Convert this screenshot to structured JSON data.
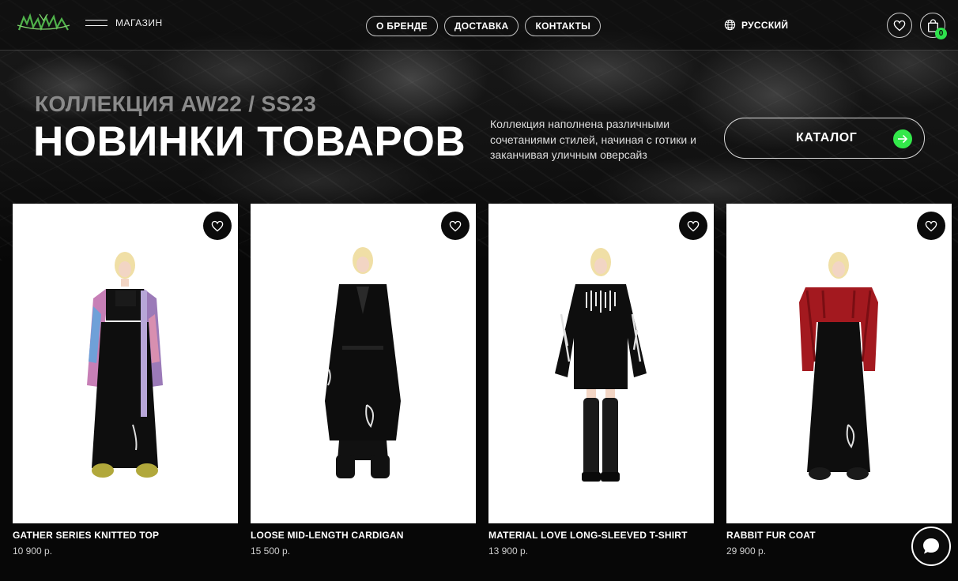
{
  "header": {
    "logo_icon": "brand-logo",
    "menu_label": "МАГАЗИН",
    "nav": [
      "О БРЕНДЕ",
      "ДОСТАВКА",
      "КОНТАКТЫ"
    ],
    "language": "РУССКИЙ",
    "cart_count": "0"
  },
  "hero": {
    "collection": "КОЛЛЕКЦИЯ AW22 / SS23",
    "title": "НОВИНКИ ТОВАРОВ",
    "description": "Коллекция наполнена различными сочетаниями стилей, начиная с готики и заканчивая уличным оверсайз",
    "catalog_label": "КАТАЛОГ"
  },
  "products": [
    {
      "name": "GATHER SERIES KNITTED TOP",
      "price": "10 900 р."
    },
    {
      "name": "LOOSE MID-LENGTH CARDIGAN",
      "price": "15 500 р."
    },
    {
      "name": "MATERIAL LOVE LONG-SLEEVED T-SHIRT",
      "price": "13 900 р."
    },
    {
      "name": "RABBIT FUR COAT",
      "price": "29 900 р."
    }
  ],
  "colors": {
    "accent_green": "#2ee24c",
    "background": "#070707",
    "collection_gray": "#8a8a8a"
  }
}
